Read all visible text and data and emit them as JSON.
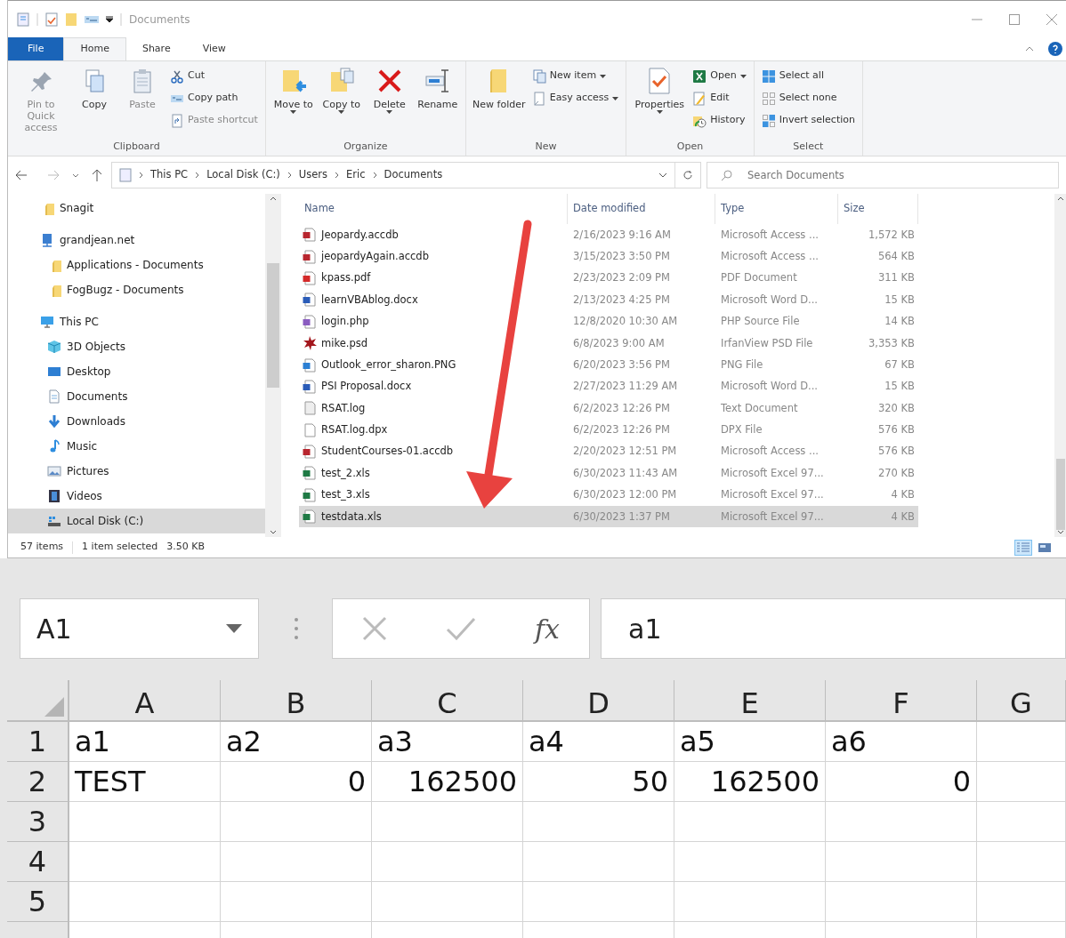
{
  "window": {
    "title": "Documents"
  },
  "ribbon_tabs": [
    {
      "label": "File",
      "selected": false,
      "kind": "file"
    },
    {
      "label": "Home",
      "selected": true,
      "kind": "tab"
    },
    {
      "label": "Share",
      "selected": false,
      "kind": "tab"
    },
    {
      "label": "View",
      "selected": false,
      "kind": "tab"
    }
  ],
  "ribbon_groups": [
    {
      "label": "Clipboard",
      "buttons": [
        {
          "kind": "large",
          "label": "Pin to Quick access",
          "disabled": true,
          "dropdown": false
        },
        {
          "kind": "large",
          "label": "Copy",
          "disabled": false,
          "dropdown": false
        },
        {
          "kind": "large",
          "label": "Paste",
          "disabled": true,
          "dropdown": false
        },
        {
          "kind": "small",
          "label": "Cut",
          "disabled": false,
          "dropdown": false
        },
        {
          "kind": "small",
          "label": "Copy path",
          "disabled": false,
          "dropdown": false
        },
        {
          "kind": "small",
          "label": "Paste shortcut",
          "disabled": true,
          "dropdown": false
        }
      ]
    },
    {
      "label": "Organize",
      "buttons": [
        {
          "kind": "large",
          "label": "Move to",
          "disabled": false,
          "dropdown": true
        },
        {
          "kind": "large",
          "label": "Copy to",
          "disabled": false,
          "dropdown": true
        },
        {
          "kind": "large",
          "label": "Delete",
          "disabled": false,
          "dropdown": true
        },
        {
          "kind": "large",
          "label": "Rename",
          "disabled": false,
          "dropdown": false
        }
      ]
    },
    {
      "label": "New",
      "buttons": [
        {
          "kind": "large",
          "label": "New folder",
          "disabled": false,
          "dropdown": false
        },
        {
          "kind": "small",
          "label": "New item",
          "disabled": false,
          "dropdown": true
        },
        {
          "kind": "small",
          "label": "Easy access",
          "disabled": false,
          "dropdown": true
        }
      ]
    },
    {
      "label": "Open",
      "buttons": [
        {
          "kind": "large",
          "label": "Properties",
          "disabled": false,
          "dropdown": true
        },
        {
          "kind": "small",
          "label": "Open",
          "disabled": false,
          "dropdown": true
        },
        {
          "kind": "small",
          "label": "Edit",
          "disabled": false,
          "dropdown": false
        },
        {
          "kind": "small",
          "label": "History",
          "disabled": false,
          "dropdown": false
        }
      ]
    },
    {
      "label": "Select",
      "buttons": [
        {
          "kind": "small",
          "label": "Select all",
          "disabled": false,
          "dropdown": false
        },
        {
          "kind": "small",
          "label": "Select none",
          "disabled": false,
          "dropdown": false
        },
        {
          "kind": "small",
          "label": "Invert selection",
          "disabled": false,
          "dropdown": false
        }
      ]
    }
  ],
  "address": {
    "crumbs": [
      "This PC",
      "Local Disk (C:)",
      "Users",
      "Eric",
      "Documents"
    ],
    "search_placeholder": "Search Documents"
  },
  "nav_pane": [
    {
      "label": "Snagit",
      "kind": "folder",
      "selected": false
    },
    {
      "label": "grandjean.net",
      "kind": "network",
      "selected": false,
      "children": [
        {
          "label": "Applications - Documents",
          "kind": "folder",
          "selected": false
        },
        {
          "label": "FogBugz - Documents",
          "kind": "folder",
          "selected": false
        }
      ]
    },
    {
      "label": "This PC",
      "kind": "pc",
      "selected": false,
      "children": [
        {
          "label": "3D Objects",
          "kind": "cube",
          "selected": false
        },
        {
          "label": "Desktop",
          "kind": "desktop",
          "selected": false
        },
        {
          "label": "Documents",
          "kind": "docs",
          "selected": false
        },
        {
          "label": "Downloads",
          "kind": "download",
          "selected": false
        },
        {
          "label": "Music",
          "kind": "music",
          "selected": false
        },
        {
          "label": "Pictures",
          "kind": "pictures",
          "selected": false
        },
        {
          "label": "Videos",
          "kind": "videos",
          "selected": false
        },
        {
          "label": "Local Disk (C:)",
          "kind": "drive",
          "selected": true
        }
      ]
    }
  ],
  "file_list": {
    "columns": [
      "Name",
      "Date modified",
      "Type",
      "Size"
    ],
    "rows": [
      {
        "name": "Jeopardy.accdb",
        "date": "2/16/2023 9:16 AM",
        "type": "Microsoft Access ...",
        "size": "1,572 KB",
        "kind": "access",
        "selected": false
      },
      {
        "name": "jeopardyAgain.accdb",
        "date": "3/15/2023 3:50 PM",
        "type": "Microsoft Access ...",
        "size": "564 KB",
        "kind": "access",
        "selected": false
      },
      {
        "name": "kpass.pdf",
        "date": "2/23/2023 2:09 PM",
        "type": "PDF Document",
        "size": "311 KB",
        "kind": "pdf",
        "selected": false
      },
      {
        "name": "learnVBAblog.docx",
        "date": "2/13/2023 4:25 PM",
        "type": "Microsoft Word D...",
        "size": "15 KB",
        "kind": "word",
        "selected": false
      },
      {
        "name": "login.php",
        "date": "12/8/2020 10:30 AM",
        "type": "PHP Source File",
        "size": "14 KB",
        "kind": "php",
        "selected": false
      },
      {
        "name": "mike.psd",
        "date": "6/8/2023 9:00 AM",
        "type": "IrfanView PSD File",
        "size": "3,353 KB",
        "kind": "psd",
        "selected": false
      },
      {
        "name": "Outlook_error_sharon.PNG",
        "date": "6/20/2023 3:56 PM",
        "type": "PNG File",
        "size": "67 KB",
        "kind": "png",
        "selected": false
      },
      {
        "name": "PSI Proposal.docx",
        "date": "2/27/2023 11:29 AM",
        "type": "Microsoft Word D...",
        "size": "15 KB",
        "kind": "word",
        "selected": false
      },
      {
        "name": "RSAT.log",
        "date": "6/2/2023 12:26 PM",
        "type": "Text Document",
        "size": "320 KB",
        "kind": "text",
        "selected": false
      },
      {
        "name": "RSAT.log.dpx",
        "date": "6/2/2023 12:26 PM",
        "type": "DPX File",
        "size": "576 KB",
        "kind": "blank",
        "selected": false
      },
      {
        "name": "StudentCourses-01.accdb",
        "date": "2/20/2023 12:51 PM",
        "type": "Microsoft Access ...",
        "size": "576 KB",
        "kind": "access",
        "selected": false
      },
      {
        "name": "test_2.xls",
        "date": "6/30/2023 11:43 AM",
        "type": "Microsoft Excel 97...",
        "size": "270 KB",
        "kind": "excel",
        "selected": false
      },
      {
        "name": "test_3.xls",
        "date": "6/30/2023 12:00 PM",
        "type": "Microsoft Excel 97...",
        "size": "4 KB",
        "kind": "excel",
        "selected": false
      },
      {
        "name": "testdata.xls",
        "date": "6/30/2023 1:37 PM",
        "type": "Microsoft Excel 97...",
        "size": "4 KB",
        "kind": "excel",
        "selected": true
      }
    ]
  },
  "status_bar": {
    "item_count": "57 items",
    "selection": "1 item selected",
    "selection_size": "3.50 KB",
    "views": [
      {
        "kind": "details",
        "selected": true
      },
      {
        "kind": "large_icons",
        "selected": false
      }
    ]
  },
  "spreadsheet": {
    "name_box": "A1",
    "function_label": "fx",
    "formula": "a1",
    "columns": [
      "A",
      "B",
      "C",
      "D",
      "E",
      "F",
      "G"
    ],
    "rows": [
      {
        "header": "1",
        "cells": [
          {
            "text": "a1",
            "kind": "text"
          },
          {
            "text": "a2",
            "kind": "text"
          },
          {
            "text": "a3",
            "kind": "text"
          },
          {
            "text": "a4",
            "kind": "text"
          },
          {
            "text": "a5",
            "kind": "text"
          },
          {
            "text": "a6",
            "kind": "text"
          }
        ]
      },
      {
        "header": "2",
        "cells": [
          {
            "text": "TEST",
            "kind": "text"
          },
          {
            "text": "0",
            "kind": "number"
          },
          {
            "text": "162500",
            "kind": "number"
          },
          {
            "text": "50",
            "kind": "number"
          },
          {
            "text": "162500",
            "kind": "number"
          },
          {
            "text": "0",
            "kind": "number"
          }
        ]
      },
      {
        "header": "3",
        "cells": []
      },
      {
        "header": "4",
        "cells": []
      },
      {
        "header": "5",
        "cells": []
      }
    ]
  }
}
